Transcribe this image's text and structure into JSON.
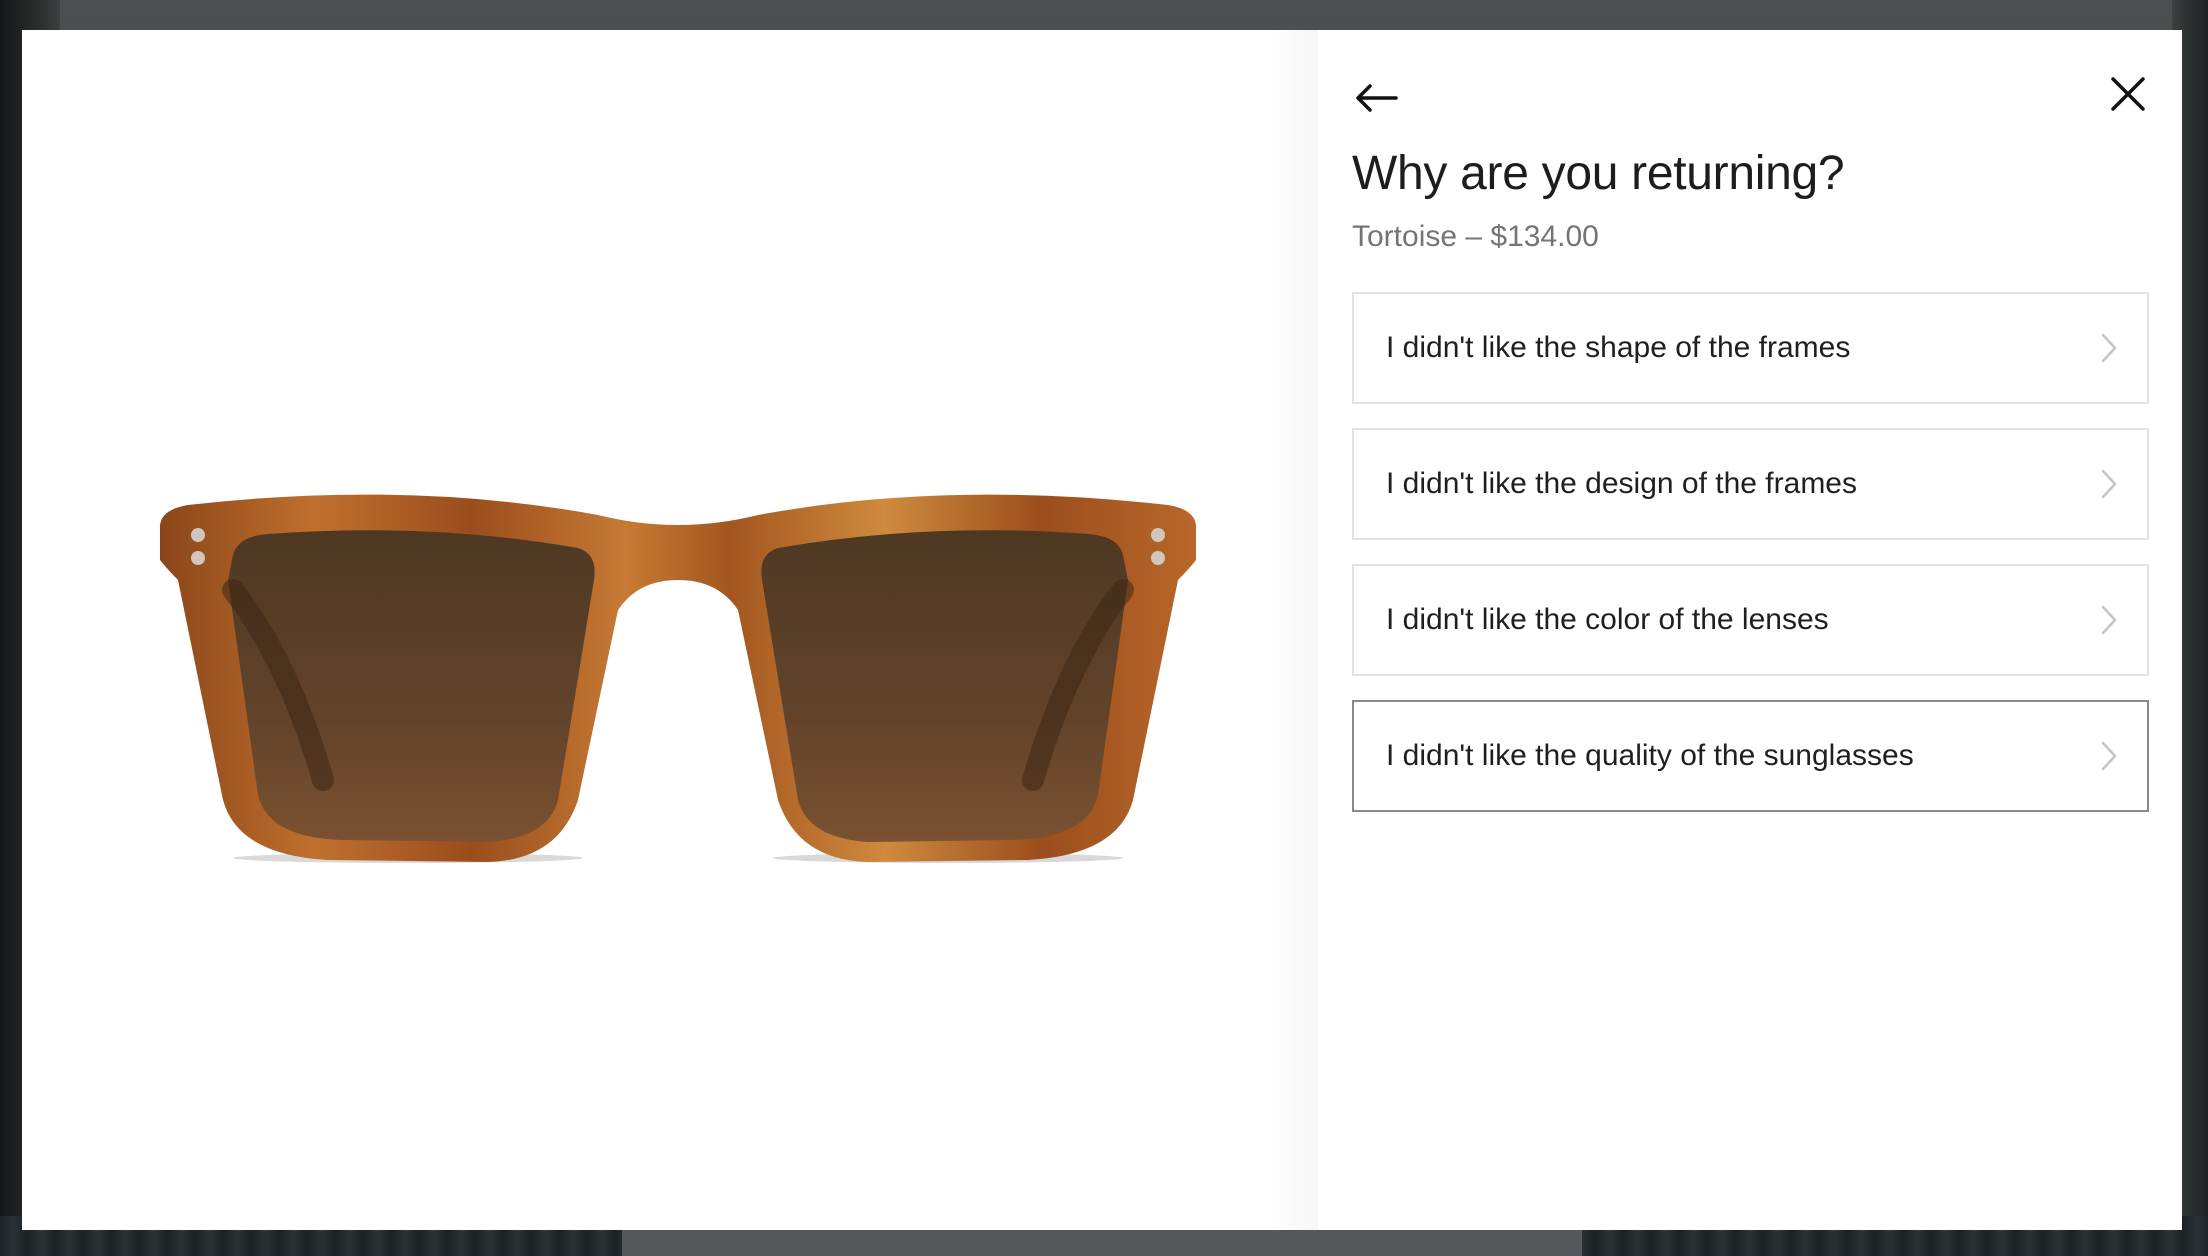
{
  "modal": {
    "title": "Why are you returning?",
    "subtitle": "Tortoise – $134.00",
    "back_icon": "arrow-left-icon",
    "close_icon": "close-icon",
    "reasons": [
      {
        "label": "I didn't like the shape of the frames",
        "selected": false
      },
      {
        "label": "I didn't like the design of the frames",
        "selected": false
      },
      {
        "label": "I didn't like the color of the lenses",
        "selected": false
      },
      {
        "label": "I didn't like the quality of the sunglasses",
        "selected": true
      }
    ]
  },
  "product_image": {
    "subject": "tortoise-sunglasses",
    "colors": {
      "frame": "#a85a26",
      "frame_dark": "#7a3c15",
      "frame_light": "#d08a3a",
      "lens": "#5b3e25"
    }
  },
  "colors": {
    "title_text": "#1d1d1d",
    "subtitle_text": "#747474",
    "option_border": "#e2e2e2",
    "selected_border": "#8a8a8a",
    "chevron": "#c4c4c4"
  }
}
